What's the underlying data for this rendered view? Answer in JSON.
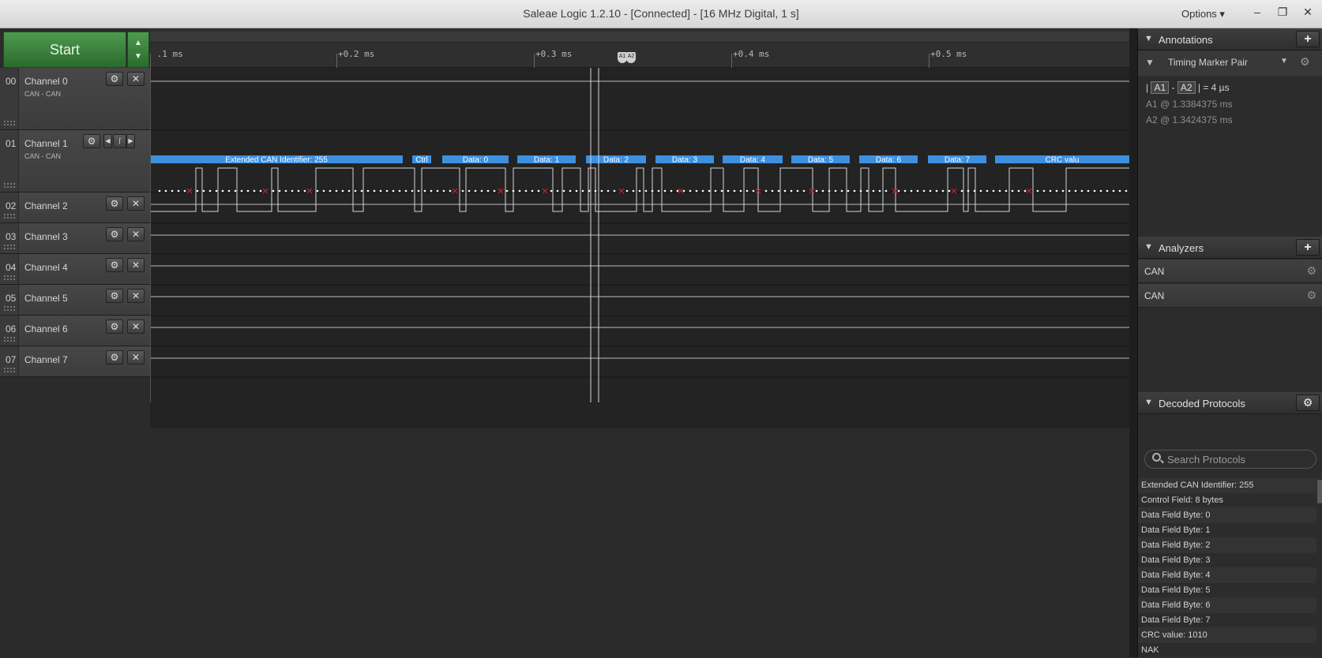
{
  "window": {
    "title": "Saleae Logic 1.2.10 - [Connected] - [16 MHz Digital, 1 s]",
    "options_label": "Options ▾",
    "minimize": "–",
    "restore": "❐",
    "close": "✕"
  },
  "capture": {
    "start_label": "Start",
    "speed_up": "▲",
    "speed_down": "▼"
  },
  "ruler": {
    "ticks": [
      " .1 ms",
      "+0.2 ms",
      "+0.3 ms",
      "+0.4 ms",
      "+0.5 ms"
    ],
    "marker_a1": "A1",
    "marker_a2": "A2"
  },
  "channels": [
    {
      "num": "00",
      "name": "Channel 0",
      "sub": "CAN - CAN",
      "color": "#5a5a5a"
    },
    {
      "num": "01",
      "name": "Channel 1",
      "sub": "CAN - CAN",
      "color": "#b8742f"
    },
    {
      "num": "02",
      "name": "Channel 2",
      "sub": "",
      "color": "#d03030"
    },
    {
      "num": "03",
      "name": "Channel 3",
      "sub": "",
      "color": "#e48a1a"
    },
    {
      "num": "04",
      "name": "Channel 4",
      "sub": "",
      "color": "#e8c51a"
    },
    {
      "num": "05",
      "name": "Channel 5",
      "sub": "",
      "color": "#3da13d"
    },
    {
      "num": "06",
      "name": "Channel 6",
      "sub": "",
      "color": "#3a5fc8"
    },
    {
      "num": "07",
      "name": "Channel 7",
      "sub": "",
      "color": "#9a3fc1"
    }
  ],
  "channel_buttons": {
    "gear": "⚙",
    "close": "✕",
    "nav_left": "◀",
    "trigger": "ʃ",
    "nav_right": "▶"
  },
  "decoded_bubbles": [
    "Extended CAN Identifier: 255",
    "Ctrl",
    "Data: 0",
    "Data: 1",
    "Data: 2",
    "Data: 3",
    "Data: 4",
    "Data: 5",
    "Data: 6",
    "Data: 7",
    "CRC valu"
  ],
  "annotations": {
    "header": "Annotations",
    "add": "+",
    "marker_pair": "Timing Marker Pair",
    "measure_prefix": "|",
    "measure_a1": "A1",
    "measure_dash": "-",
    "measure_a2": "A2",
    "measure_result": "| = 4 µs",
    "a1_label": "A1 @ 1.3384375 ms",
    "a2_label": "A2 @ 1.3424375 ms"
  },
  "analyzers": {
    "header": "Analyzers",
    "add": "+",
    "items": [
      "CAN",
      "CAN"
    ]
  },
  "decoded_protocols": {
    "header": "Decoded Protocols",
    "search_placeholder": "Search Protocols",
    "items": [
      "Extended CAN Identifier: 255",
      "Control Field: 8 bytes",
      "Data Field Byte: 0",
      "Data Field Byte: 1",
      "Data Field Byte: 2",
      "Data Field Byte: 3",
      "Data Field Byte: 4",
      "Data Field Byte: 5",
      "Data Field Byte: 6",
      "Data Field Byte: 7",
      "CRC value: 1010",
      "NAK"
    ]
  },
  "colors": {
    "decode_bubble": "#3d8fe0",
    "start_green": "#3d8a3f",
    "error_x": "#d02020"
  }
}
